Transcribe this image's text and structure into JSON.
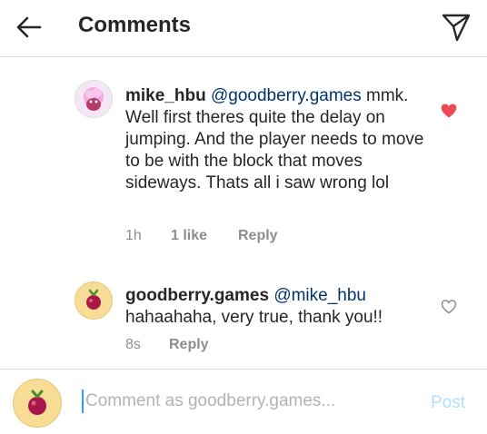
{
  "header": {
    "title": "Comments",
    "back_icon": "arrow-left-icon",
    "send_icon": "paper-plane-icon"
  },
  "comments": [
    {
      "username": "mike_hbu",
      "mention": "@goodberry.games",
      "text": "mmk. Well first theres quite the delay on jumping. And the player needs to move to be with the block that moves sideways. Thats all i saw wrong lol",
      "time": "1h",
      "likes": "1 like",
      "reply": "Reply",
      "liked": true
    },
    {
      "username": "goodberry.games",
      "mention": "@mike_hbu",
      "text": "hahaahaha, very true, thank you!!",
      "time": "8s",
      "reply": "Reply",
      "liked": false
    }
  ],
  "composer": {
    "placeholder": "Comment as goodberry.games...",
    "post_label": "Post"
  },
  "colors": {
    "like_red": "#ed4956",
    "mention_blue": "#003569",
    "post_disabled": "#b2dffc",
    "berry_bg": "#f7dc96"
  }
}
